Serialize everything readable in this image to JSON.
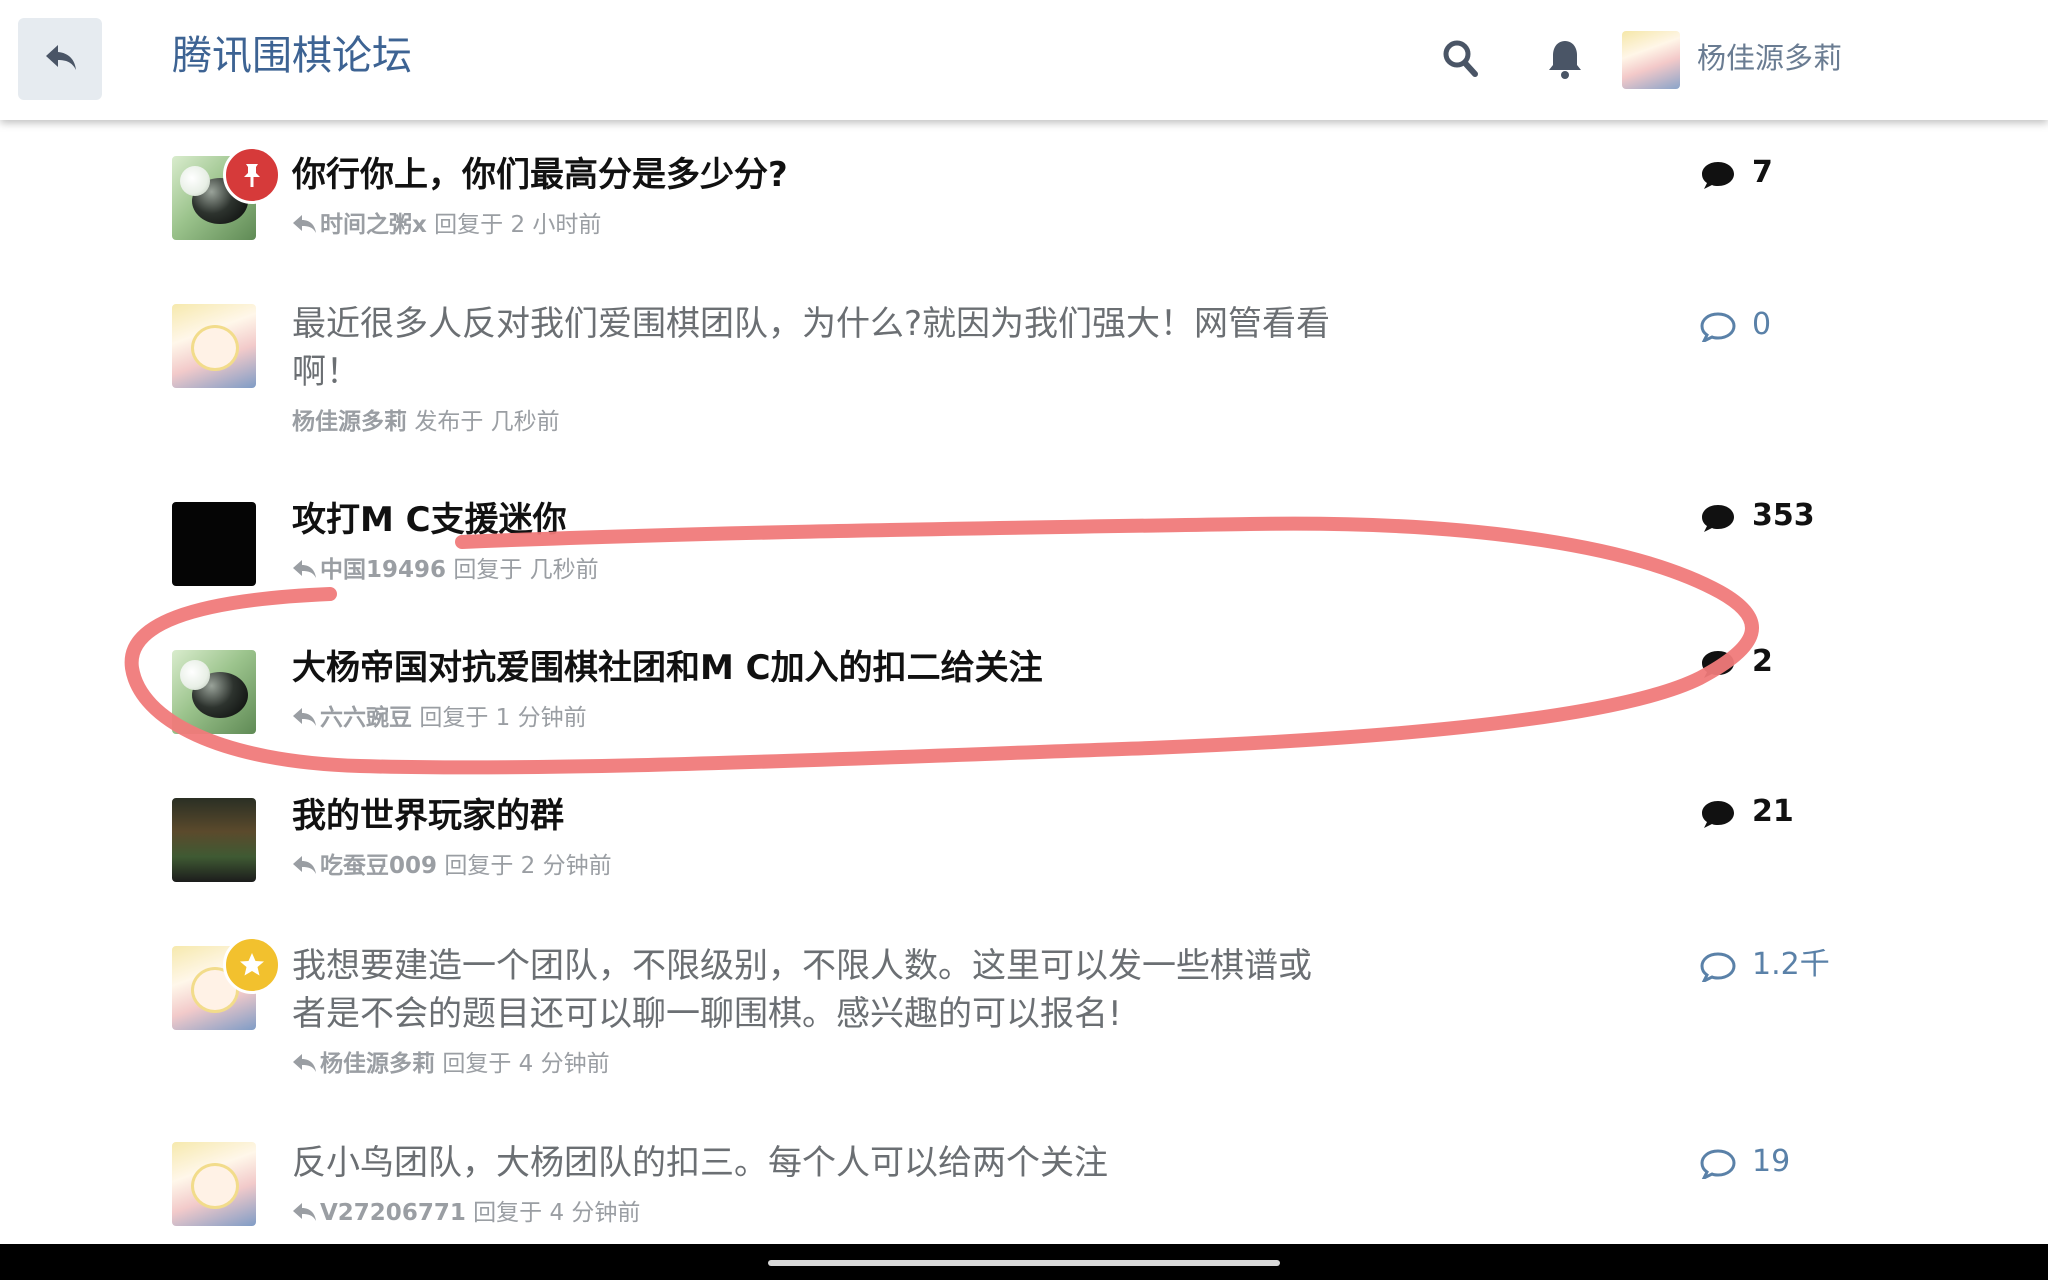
{
  "header": {
    "site_title": "腾讯围棋论坛",
    "username": "杨佳源多莉",
    "back_icon": "reply-arrow-icon",
    "search_icon": "search-icon",
    "notification_icon": "bell-icon",
    "title_color": "#3d6393"
  },
  "topics": [
    {
      "title": "你行你上，你们最高分是多少分?",
      "user": "时间之粥x",
      "action": "回复于 2 小时前",
      "count": "7",
      "unread": true,
      "pinned": true,
      "avatar": "go-stones"
    },
    {
      "title": "最近很多人反对我们爱围棋团队，为什么?就因为我们强大！网管看看啊！",
      "user": "杨佳源多莉",
      "action": "发布于 几秒前",
      "count": "0",
      "unread": false,
      "avatar": "anime-girl"
    },
    {
      "title": "攻打M C支援迷你",
      "user": "中国19496",
      "action": "回复于 几秒前",
      "count": "353",
      "unread": true,
      "avatar": "black"
    },
    {
      "title": "大杨帝国对抗爱围棋社团和M C加入的扣二给关注",
      "user": "六六豌豆",
      "action": "回复于 1 分钟前",
      "count": "2",
      "unread": true,
      "avatar": "go-stones"
    },
    {
      "title": "我的世界玩家的群",
      "user": "吃蚕豆009",
      "action": "回复于 2 分钟前",
      "count": "21",
      "unread": true,
      "avatar": "minecraft"
    },
    {
      "title": "我想要建造一个团队，不限级别，不限人数。这里可以发一些棋谱或者是不会的题目还可以聊一聊围棋。感兴趣的可以报名!",
      "user": "杨佳源多莉",
      "action": "回复于 4 分钟前",
      "count": "1.2千",
      "unread": false,
      "starred": true,
      "avatar": "anime-girl"
    },
    {
      "title": "反小鸟团队，大杨团队的扣三。每个人可以给两个关注",
      "user": "V27206771",
      "action": "回复于 4 分钟前",
      "count": "19",
      "unread": false,
      "avatar": "anime-girl"
    }
  ],
  "annotation_color": "#f07a7a",
  "comment_icon": "comment-bubble-icon",
  "reply_icon": "reply-arrow-icon"
}
